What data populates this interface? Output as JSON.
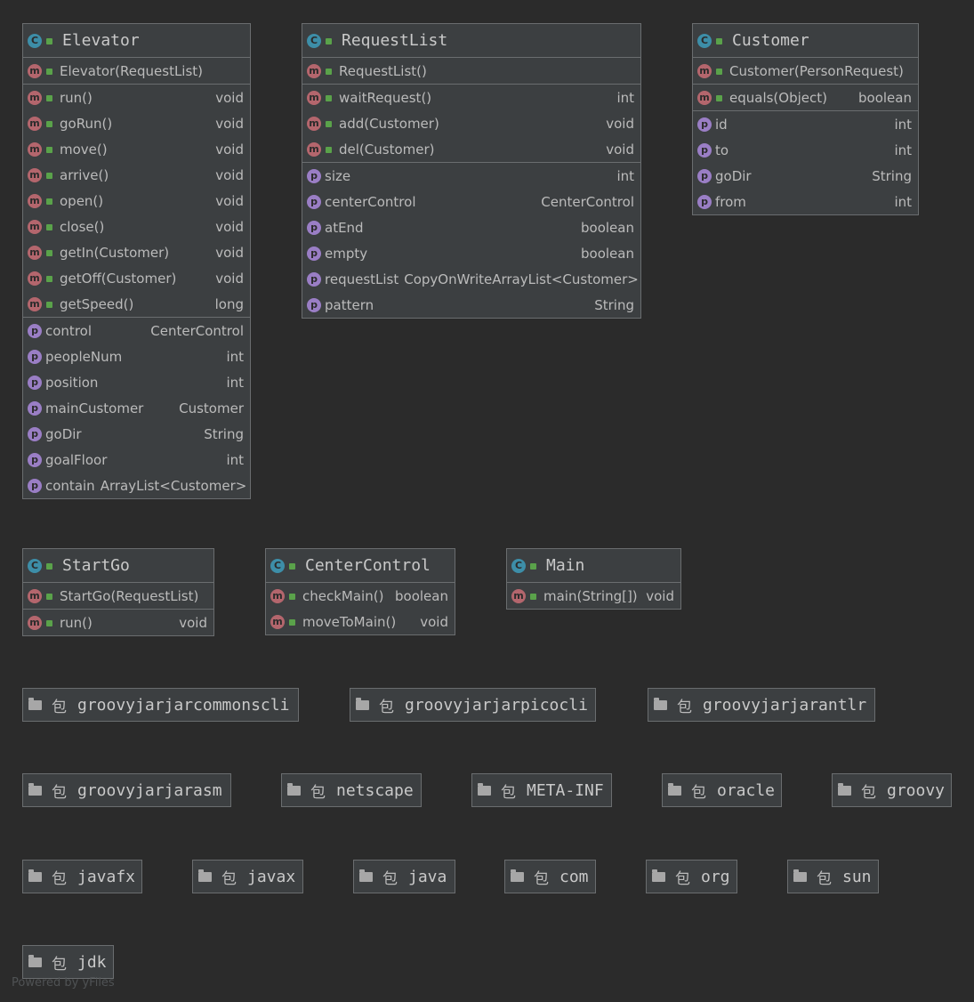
{
  "classes": {
    "elevator": {
      "name": "Elevator",
      "constructor": "Elevator(RequestList)",
      "methods": [
        {
          "name": "run()",
          "type": "void"
        },
        {
          "name": "goRun()",
          "type": "void"
        },
        {
          "name": "move()",
          "type": "void"
        },
        {
          "name": "arrive()",
          "type": "void"
        },
        {
          "name": "open()",
          "type": "void"
        },
        {
          "name": "close()",
          "type": "void"
        },
        {
          "name": "getIn(Customer)",
          "type": "void"
        },
        {
          "name": "getOff(Customer)",
          "type": "void"
        },
        {
          "name": "getSpeed()",
          "type": "long"
        }
      ],
      "fields": [
        {
          "name": "control",
          "type": "CenterControl"
        },
        {
          "name": "peopleNum",
          "type": "int"
        },
        {
          "name": "position",
          "type": "int"
        },
        {
          "name": "mainCustomer",
          "type": "Customer"
        },
        {
          "name": "goDir",
          "type": "String"
        },
        {
          "name": "goalFloor",
          "type": "int"
        },
        {
          "name": "contain",
          "type": "ArrayList<Customer>"
        }
      ]
    },
    "requestlist": {
      "name": "RequestList",
      "constructor": "RequestList()",
      "methods": [
        {
          "name": "waitRequest()",
          "type": "int"
        },
        {
          "name": "add(Customer)",
          "type": "void"
        },
        {
          "name": "del(Customer)",
          "type": "void"
        }
      ],
      "fields": [
        {
          "name": "size",
          "type": "int"
        },
        {
          "name": "centerControl",
          "type": "CenterControl"
        },
        {
          "name": "atEnd",
          "type": "boolean"
        },
        {
          "name": "empty",
          "type": "boolean"
        },
        {
          "name": "requestList",
          "type": "CopyOnWriteArrayList<Customer>"
        },
        {
          "name": "pattern",
          "type": "String"
        }
      ]
    },
    "customer": {
      "name": "Customer",
      "constructor": "Customer(PersonRequest)",
      "methods": [
        {
          "name": "equals(Object)",
          "type": "boolean"
        }
      ],
      "fields": [
        {
          "name": "id",
          "type": "int"
        },
        {
          "name": "to",
          "type": "int"
        },
        {
          "name": "goDir",
          "type": "String"
        },
        {
          "name": "from",
          "type": "int"
        }
      ]
    },
    "startgo": {
      "name": "StartGo",
      "constructor": "StartGo(RequestList)",
      "methods": [
        {
          "name": "run()",
          "type": "void"
        }
      ]
    },
    "centercontrol": {
      "name": "CenterControl",
      "methods": [
        {
          "name": "checkMain()",
          "type": "boolean"
        },
        {
          "name": "moveToMain()",
          "type": "void"
        }
      ]
    },
    "main": {
      "name": "Main",
      "methods": [
        {
          "name": "main(String[])",
          "type": "void"
        }
      ]
    }
  },
  "icons": {
    "class": "C",
    "method": "m",
    "property": "p"
  },
  "package_word": "包",
  "packages": [
    "groovyjarjarcommonscli",
    "groovyjarjarpicocli",
    "groovyjarjarantlr",
    "groovyjarjarasm",
    "netscape",
    "META-INF",
    "oracle",
    "groovy",
    "javafx",
    "javax",
    "java",
    "com",
    "org",
    "sun",
    "jdk"
  ],
  "footer": "Powered by yFiles",
  "colors": {
    "background": "#2b2b2b",
    "node": "#3c3f41",
    "class_icon": "#3d8ea8",
    "method_icon": "#b4666d",
    "property_icon": "#9a7ec5",
    "access_icon": "#5aa24a"
  }
}
